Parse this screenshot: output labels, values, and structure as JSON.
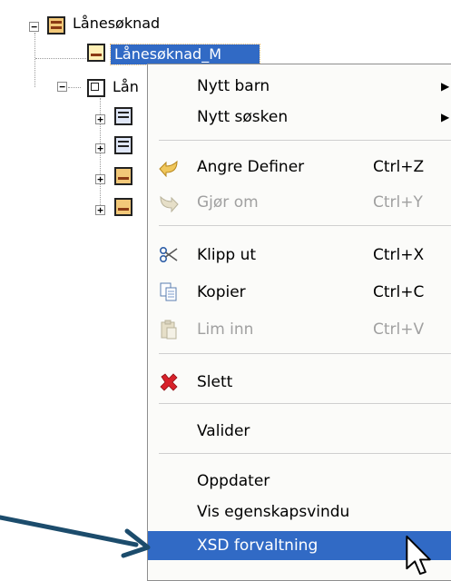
{
  "tree": {
    "root_label": "Lånesøknad",
    "selected_label": "Lånesøknad_M",
    "child_label": "Lån"
  },
  "context_menu": {
    "items": [
      {
        "label": "Nytt barn",
        "shortcut": "",
        "submenu": "▶"
      },
      {
        "label": "Nytt søsken",
        "shortcut": "",
        "submenu": "▶"
      },
      {
        "label": "Angre Definer",
        "shortcut": "Ctrl+Z"
      },
      {
        "label": "Gjør om",
        "shortcut": "Ctrl+Y"
      },
      {
        "label": "Klipp ut",
        "shortcut": "Ctrl+X"
      },
      {
        "label": "Kopier",
        "shortcut": "Ctrl+C"
      },
      {
        "label": "Lim inn",
        "shortcut": "Ctrl+V"
      },
      {
        "label": "Slett",
        "shortcut": ""
      },
      {
        "label": "Valider",
        "shortcut": ""
      },
      {
        "label": "Oppdater",
        "shortcut": ""
      },
      {
        "label": "Vis egenskapsvindu",
        "shortcut": ""
      },
      {
        "label": "XSD forvaltning",
        "shortcut": ""
      }
    ],
    "highlighted_item": "XSD forvaltning",
    "disabled_items": [
      "Gjør om",
      "Lim inn"
    ]
  },
  "icons": {
    "undo": "undo-arrow-icon",
    "redo": "redo-arrow-icon",
    "cut": "scissors-icon",
    "copy": "copy-icon",
    "paste": "paste-icon",
    "delete": "red-x-icon"
  },
  "colors": {
    "selection": "#316ac5",
    "annotation_arrow": "#1c4c6c",
    "delete_icon": "#d8212a",
    "undo_icon": "#e8b93a"
  }
}
